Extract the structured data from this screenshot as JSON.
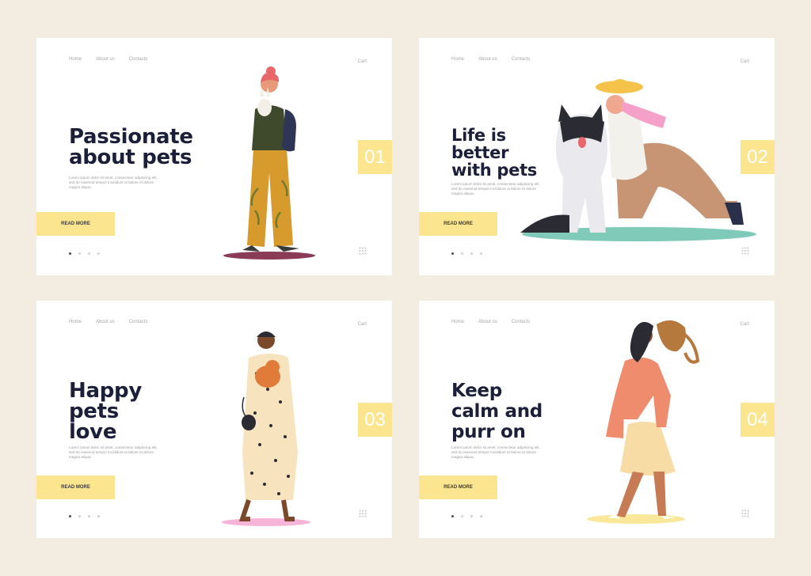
{
  "colors": {
    "background": "#f3ece1",
    "card": "#ffffff",
    "accent_yellow": "#fbe58f",
    "headline": "#1c1f3a",
    "muted_text": "#a7a7a7"
  },
  "cards": [
    {
      "nav": [
        "Home",
        "About us",
        "Contacts"
      ],
      "cart": "Cart",
      "headline_lines": [
        "Passionate",
        "about pets"
      ],
      "body": "Lorem ipsum dolor sit amet, consectetur adipiscing elit, sed do eiusmod tempor incididunt ut labore et dolore magna aliqua.",
      "cta": "READ MORE",
      "number": "01",
      "active_dot": 0,
      "grid_icon": "grid-icon"
    },
    {
      "nav": [
        "Home",
        "About us",
        "Contacts"
      ],
      "cart": "Cart",
      "headline_lines": [
        "Life is",
        "better",
        "with pets"
      ],
      "body": "Lorem ipsum dolor sit amet, consectetur adipiscing elit, sed do eiusmod tempor incididunt ut labore et dolore magna aliqua.",
      "cta": "READ MORE",
      "number": "02",
      "active_dot": 0,
      "grid_icon": "grid-icon"
    },
    {
      "nav": [
        "Home",
        "About us",
        "Contacts"
      ],
      "cart": "Cart",
      "headline_lines": [
        "Happy",
        "pets",
        "love"
      ],
      "body": "Lorem ipsum dolor sit amet, consectetur adipiscing elit, sed do eiusmod tempor incididunt ut labore et dolore magna aliqua.",
      "cta": "READ MORE",
      "number": "03",
      "active_dot": 0,
      "grid_icon": "grid-icon"
    },
    {
      "nav": [
        "Home",
        "About us",
        "Contacts"
      ],
      "cart": "Cart",
      "headline_lines": [
        "Keep",
        "calm and",
        "purr on"
      ],
      "body": "Lorem ipsum dolor sit amet, consectetur adipiscing elit, sed do eiusmod tempor incididunt ut labore et dolore magna aliqua.",
      "cta": "READ MORE",
      "number": "04",
      "active_dot": 0,
      "grid_icon": "grid-icon"
    }
  ]
}
